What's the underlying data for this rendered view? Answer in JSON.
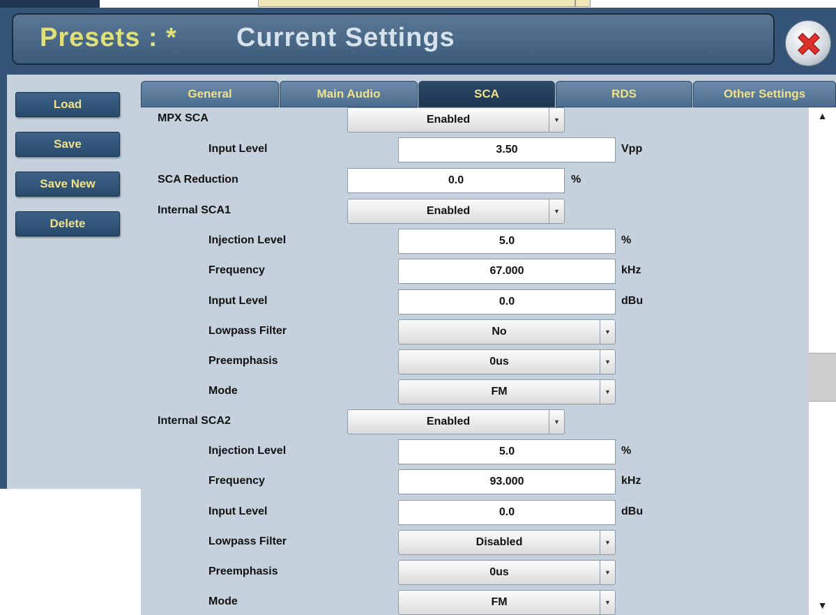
{
  "title": {
    "presets": "Presets : *",
    "current": "Current Settings"
  },
  "sidebar": [
    "Load",
    "Save",
    "Save New",
    "Delete"
  ],
  "tabs": [
    {
      "label": "General",
      "active": false
    },
    {
      "label": "Main Audio",
      "active": false
    },
    {
      "label": "SCA",
      "active": true
    },
    {
      "label": "RDS",
      "active": false
    },
    {
      "label": "Other Settings",
      "active": false
    }
  ],
  "rows": {
    "mpx_sca": {
      "label": "MPX SCA",
      "value": "Enabled"
    },
    "mpx_input_level": {
      "label": "Input Level",
      "value": "3.50",
      "unit": "Vpp"
    },
    "sca_reduction": {
      "label": "SCA Reduction",
      "value": "0.0",
      "unit": "%"
    },
    "sca1": {
      "label": "Internal SCA1",
      "value": "Enabled",
      "injection": {
        "label": "Injection Level",
        "value": "5.0",
        "unit": "%"
      },
      "frequency": {
        "label": "Frequency",
        "value": "67.000",
        "unit": "kHz"
      },
      "input": {
        "label": "Input Level",
        "value": "0.0",
        "unit": "dBu"
      },
      "lowpass": {
        "label": "Lowpass Filter",
        "value": "No"
      },
      "preemphasis": {
        "label": "Preemphasis",
        "value": "0us"
      },
      "mode": {
        "label": "Mode",
        "value": "FM"
      }
    },
    "sca2": {
      "label": "Internal SCA2",
      "value": "Enabled",
      "injection": {
        "label": "Injection Level",
        "value": "5.0",
        "unit": "%"
      },
      "frequency": {
        "label": "Frequency",
        "value": "93.000",
        "unit": "kHz"
      },
      "input": {
        "label": "Input Level",
        "value": "0.0",
        "unit": "dBu"
      },
      "lowpass": {
        "label": "Lowpass Filter",
        "value": "Disabled"
      },
      "preemphasis": {
        "label": "Preemphasis",
        "value": "0us"
      },
      "mode": {
        "label": "Mode",
        "value": "FM"
      }
    }
  },
  "icons": {
    "close": "close-x-icon",
    "dropdown": "dropdown-arrow-icon",
    "scroll_up": "scroll-up-arrow-icon",
    "scroll_down": "scroll-down-arrow-icon"
  },
  "glyphs": {
    "dropdown": "▼",
    "scroll_up": "▲",
    "scroll_down": "▼"
  },
  "colors": {
    "title_accent": "#dfe07a",
    "button_text": "#f0e28a",
    "close_red": "#e0322c"
  }
}
